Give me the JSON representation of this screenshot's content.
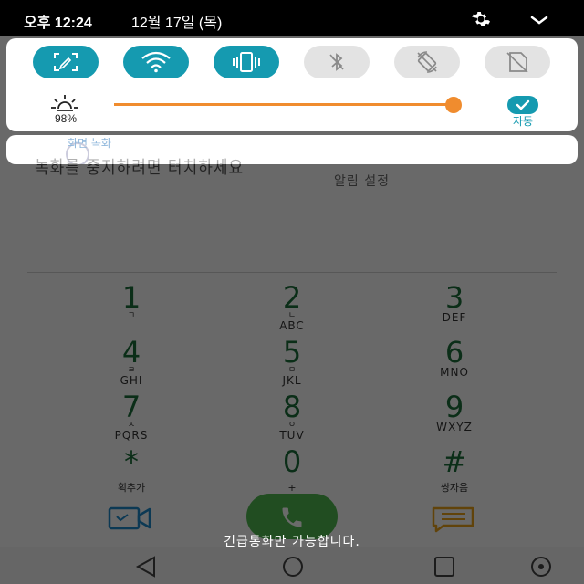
{
  "status_bar": {
    "time": "오후 12:24",
    "date": "12월 17일 (목)"
  },
  "quick_settings": {
    "toggles": [
      {
        "name": "screen-capture",
        "icon": "screen-capture-icon",
        "state": "on"
      },
      {
        "name": "wifi",
        "icon": "wifi-icon",
        "state": "on"
      },
      {
        "name": "vibrate",
        "icon": "vibrate-icon",
        "state": "on"
      },
      {
        "name": "bluetooth",
        "icon": "bluetooth-off-icon",
        "state": "off"
      },
      {
        "name": "auto-rotate",
        "icon": "auto-rotate-off-icon",
        "state": "off"
      },
      {
        "name": "sim",
        "icon": "sim-off-icon",
        "state": "off"
      }
    ],
    "brightness": {
      "value_label": "98%",
      "level": 0.98,
      "auto_label": "자동"
    },
    "colors": {
      "accent": "#159ab0",
      "slider": "#f08c2e"
    }
  },
  "background": {
    "recording_title": "화면 녹화",
    "recording_hint": "녹화를 중지하려면 터치하세요",
    "alert_settings": "알림 설정"
  },
  "dialer": {
    "keys": [
      {
        "digit": "1",
        "jamo": "ㄱ",
        "letters": ""
      },
      {
        "digit": "2",
        "jamo": "ㄴ",
        "letters": "ABC"
      },
      {
        "digit": "3",
        "jamo": "",
        "letters": "DEF"
      },
      {
        "digit": "4",
        "jamo": "ㄹ",
        "letters": "GHI"
      },
      {
        "digit": "5",
        "jamo": "ㅁ",
        "letters": "JKL"
      },
      {
        "digit": "6",
        "jamo": "",
        "letters": "MNO"
      },
      {
        "digit": "7",
        "jamo": "ㅅ",
        "letters": "PQRS"
      },
      {
        "digit": "8",
        "jamo": "ㅇ",
        "letters": "TUV"
      },
      {
        "digit": "9",
        "jamo": "",
        "letters": "WXYZ"
      },
      {
        "digit": "*",
        "jamo": "",
        "letters": "",
        "sub": "획추가"
      },
      {
        "digit": "0",
        "jamo": "",
        "letters": "",
        "sub": "+"
      },
      {
        "digit": "#",
        "jamo": "",
        "letters": "",
        "sub": "쌍자음"
      }
    ],
    "emergency_text": "긴급통화만 가능합니다."
  }
}
